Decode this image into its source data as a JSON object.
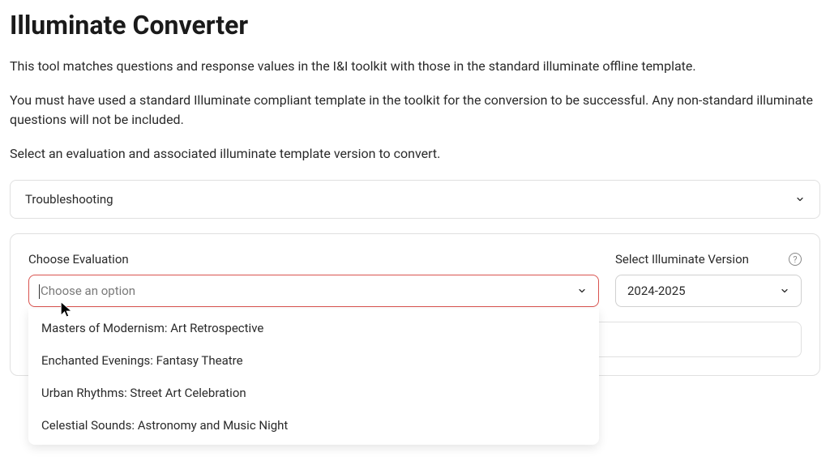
{
  "header": {
    "title": "Illuminate Converter",
    "intro1": "This tool matches questions and response values in the I&I toolkit with those in the standard illuminate offline template.",
    "intro2": "You must have used a standard Illuminate compliant template in the toolkit for the conversion to be successful. Any non-standard illuminate questions will not be included.",
    "intro3": "Select an evaluation and associated illuminate template version to convert."
  },
  "troubleshooting": {
    "label": "Troubleshooting"
  },
  "form": {
    "evaluation": {
      "label": "Choose Evaluation",
      "placeholder": "Choose an option",
      "options": [
        "Masters of Modernism: Art Retrospective",
        "Enchanted Evenings: Fantasy Theatre",
        "Urban Rhythms: Street Art Celebration",
        "Celestial Sounds: Astronomy and Music Night"
      ]
    },
    "version": {
      "label": "Select Illuminate Version",
      "selected": "2024-2025"
    }
  }
}
